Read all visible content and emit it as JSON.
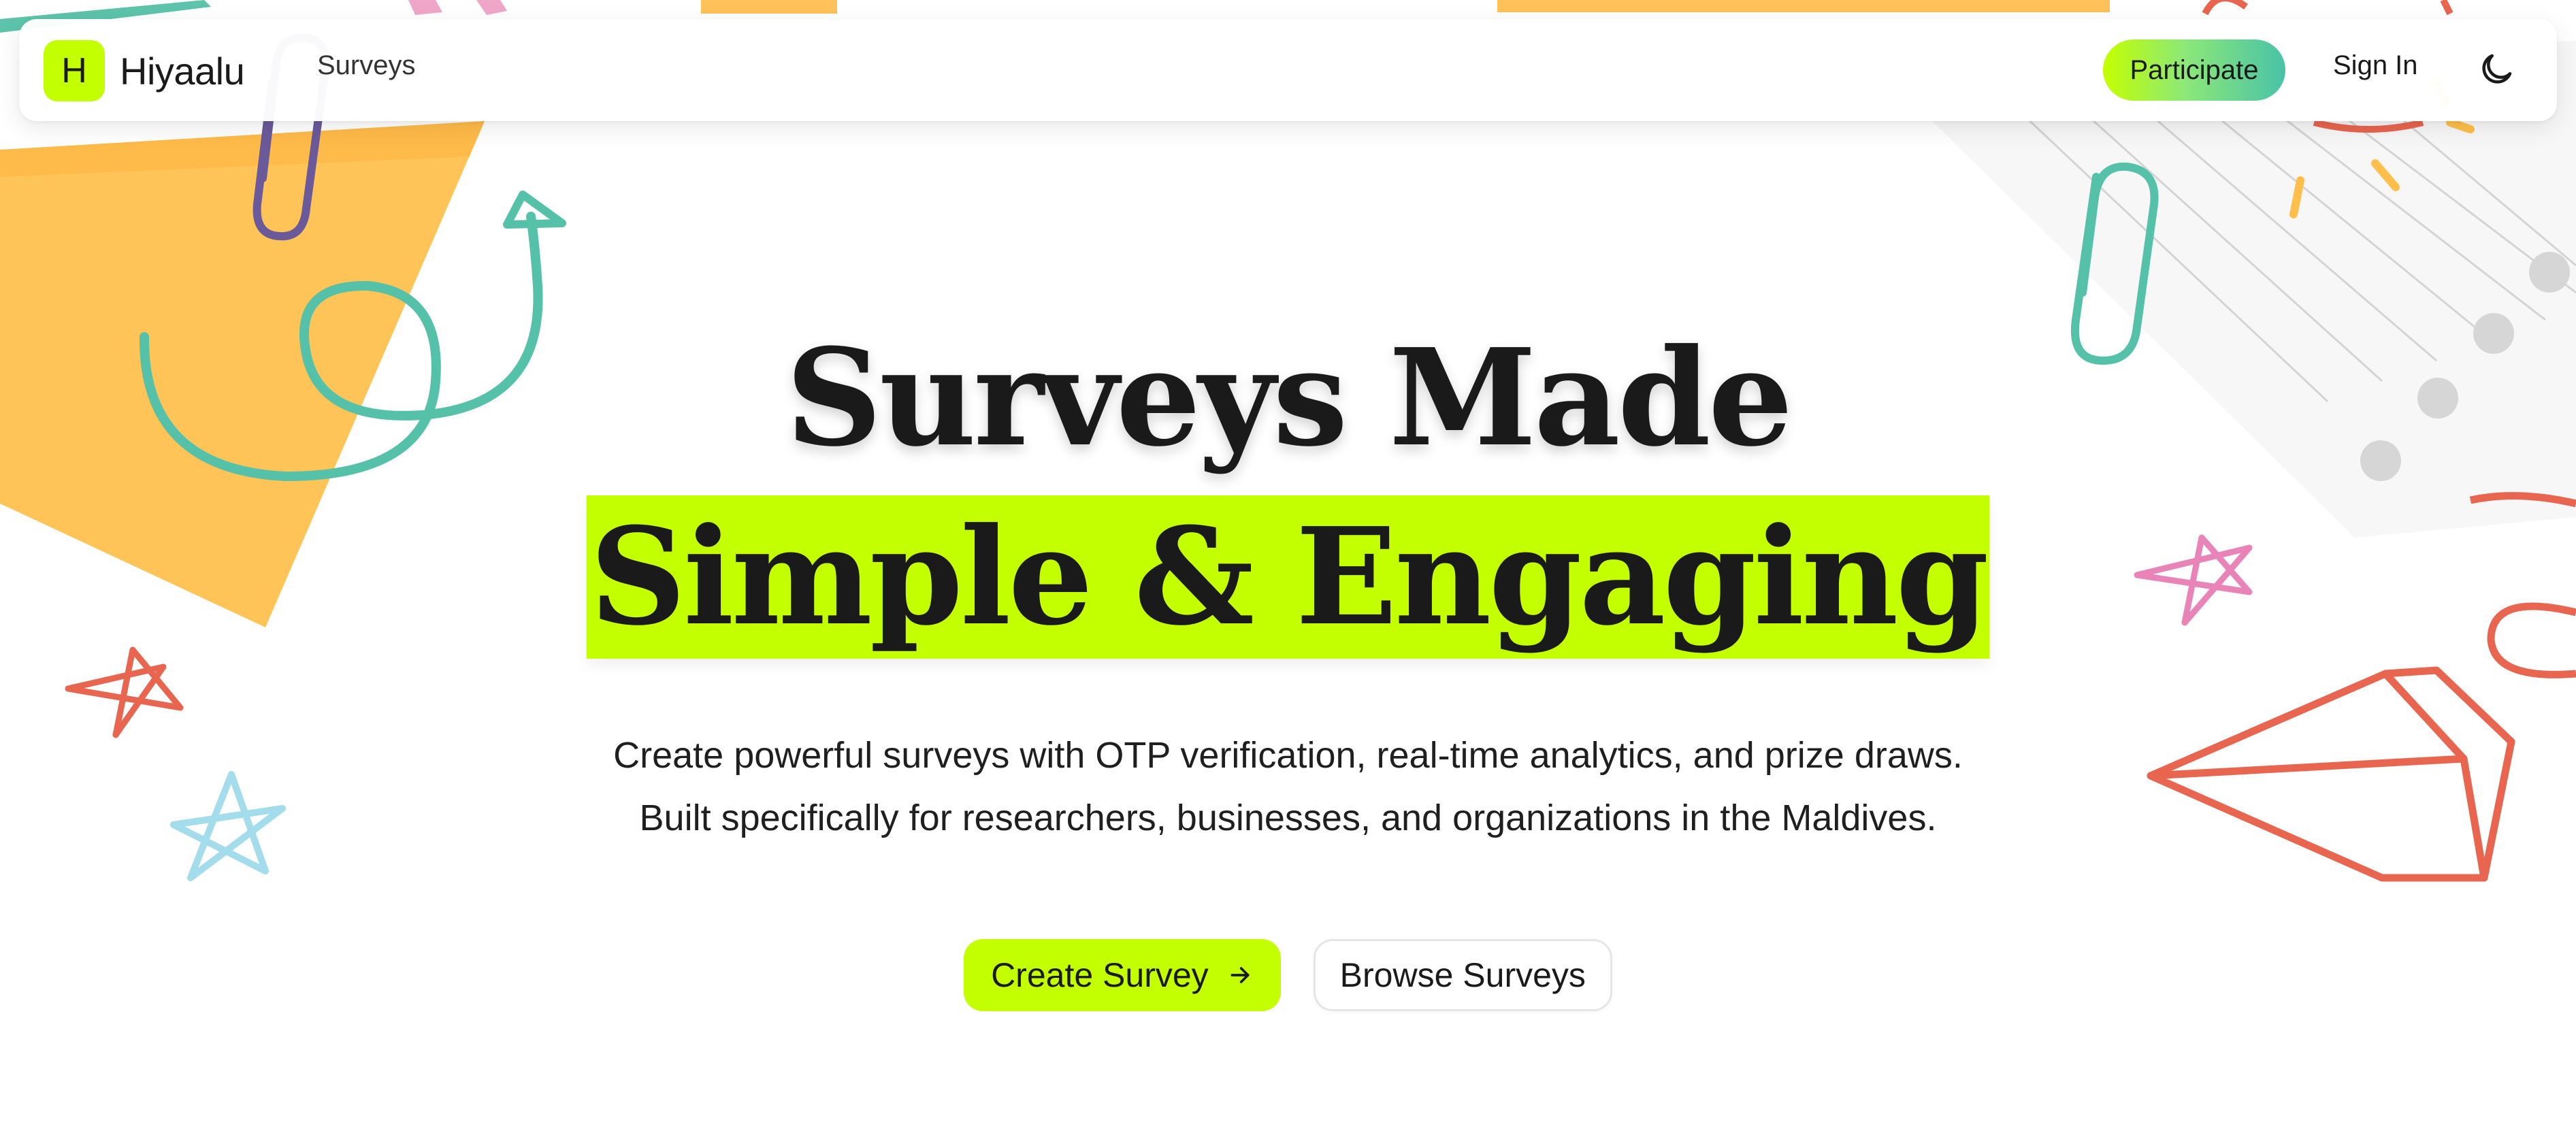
{
  "navbar": {
    "logo_letter": "H",
    "brand_name": "Hiyaalu",
    "surveys_link": "Surveys",
    "participate_label": "Participate",
    "signin_label": "Sign In",
    "theme_icon": "moon-icon"
  },
  "hero": {
    "title_line1": "Surveys Made",
    "title_line2": "Simple & Engaging",
    "subtitle_line1": "Create powerful surveys with OTP verification, real-time analytics, and prize draws.",
    "subtitle_line2": "Built specifically for researchers, businesses, and organizations in the Maldives.",
    "create_label": "Create Survey",
    "browse_label": "Browse Surveys"
  },
  "colors": {
    "accent": "#c4ff00",
    "teal": "#49c2a8",
    "orange": "#ffbf52",
    "red": "#e8654f",
    "pink": "#e884b8",
    "light_blue": "#9fd9e6",
    "purple": "#6a5a9a",
    "text": "#1a1a1a"
  }
}
